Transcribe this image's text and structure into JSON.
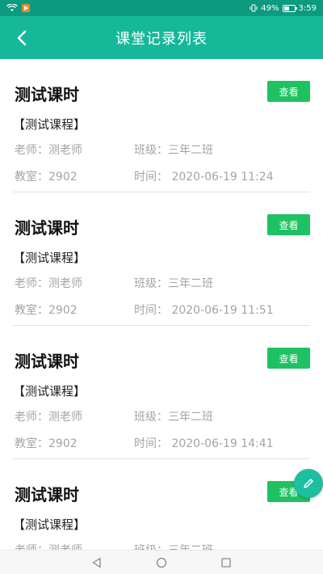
{
  "status_bar": {
    "battery": "49%",
    "time": "3:59"
  },
  "header": {
    "title": "课堂记录列表",
    "back_icon": "chevron-left-icon"
  },
  "records": [
    {
      "title": "测试课时",
      "view_label": "查看",
      "course": "【测试课程】",
      "teacher": "老师：测老师",
      "class": "班级：三年二班",
      "room": "教室：2902",
      "time": "时间：  2020-06-19 11:24"
    },
    {
      "title": "测试课时",
      "view_label": "查看",
      "course": "【测试课程】",
      "teacher": "老师：测老师",
      "class": "班级：三年二班",
      "room": "教室：2902",
      "time": "时间：  2020-06-19 11:51"
    },
    {
      "title": "测试课时",
      "view_label": "查看",
      "course": "【测试课程】",
      "teacher": "老师：测老师",
      "class": "班级：三年二班",
      "room": "教室：2902",
      "time": "时间：  2020-06-19 14:41"
    },
    {
      "title": "测试课时",
      "view_label": "查看",
      "course": "【测试课程】",
      "teacher": "老师：测老师",
      "class": "班级：三年二班"
    }
  ],
  "fab": {
    "icon": "pencil-icon"
  },
  "nav_bar": {
    "icons": [
      "back-triangle-icon",
      "home-circle-icon",
      "recents-square-icon"
    ]
  },
  "colors": {
    "header": "#17b89a",
    "status_bar": "#0c9a80",
    "button": "#1ec262",
    "meta_text": "#a4a4a4"
  }
}
